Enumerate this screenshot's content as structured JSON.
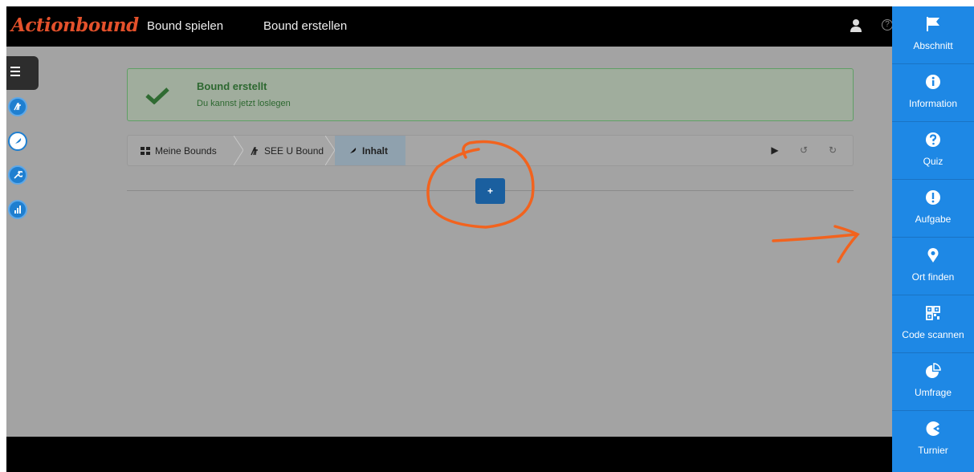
{
  "header": {
    "brand": "Actionbound",
    "nav": [
      {
        "label": "Bound spielen"
      },
      {
        "label": "Bound erstellen"
      }
    ]
  },
  "alert": {
    "title": "Bound erstellt",
    "message": "Du kannst jetzt loslegen"
  },
  "breadcrumb": [
    {
      "label": "Meine Bounds"
    },
    {
      "label": "SEE U Bound"
    },
    {
      "label": "Inhalt"
    }
  ],
  "add_button": {
    "label": "+"
  },
  "toolpanel": [
    {
      "label": "Abschnitt",
      "icon": "flag-icon"
    },
    {
      "label": "Information",
      "icon": "info-icon"
    },
    {
      "label": "Quiz",
      "icon": "question-icon"
    },
    {
      "label": "Aufgabe",
      "icon": "exclamation-icon"
    },
    {
      "label": "Ort finden",
      "icon": "map-pin-icon"
    },
    {
      "label": "Code scannen",
      "icon": "qr-code-icon"
    },
    {
      "label": "Umfrage",
      "icon": "pie-chart-icon"
    },
    {
      "label": "Turnier",
      "icon": "pacman-icon"
    }
  ],
  "colors": {
    "brand": "#e4512b",
    "panel": "#1e88e5",
    "annotation": "#f2631e",
    "success": "#2d6830"
  }
}
